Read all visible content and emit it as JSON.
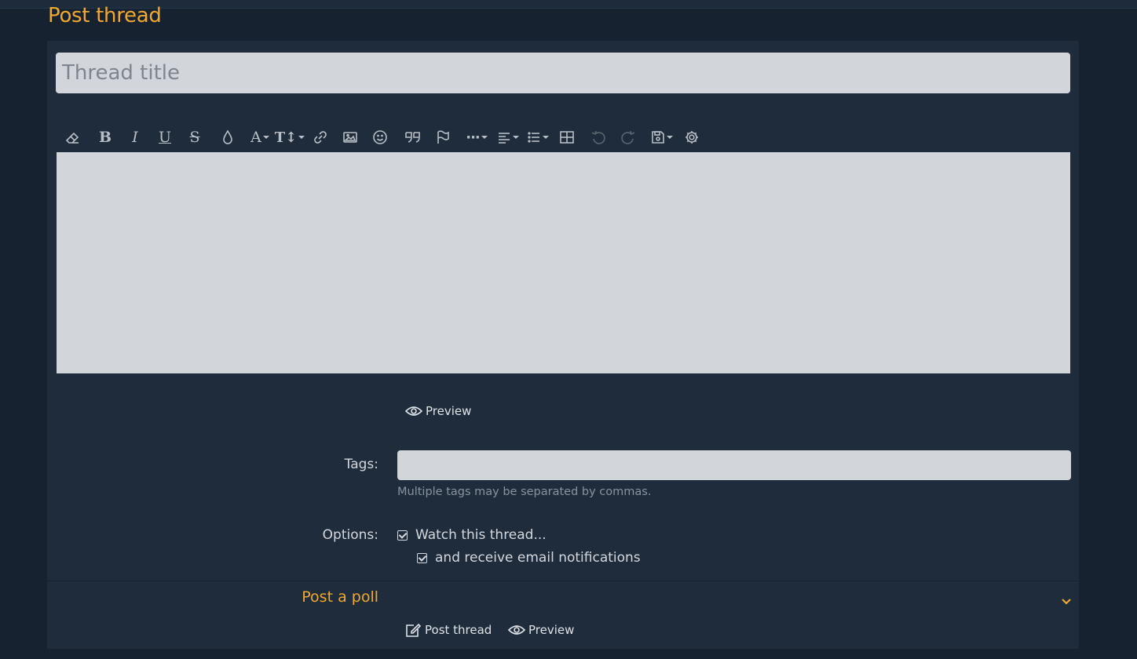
{
  "page": {
    "title": "Post thread"
  },
  "form": {
    "title_placeholder": "Thread title",
    "preview_label": "Preview",
    "tags_label": "Tags:",
    "tags_hint": "Multiple tags may be separated by commas.",
    "options_label": "Options:",
    "watch_label": "Watch this thread...",
    "email_label": "and receive email notifications",
    "poll_label": "Post a poll",
    "post_button": "Post thread",
    "preview_button": "Preview"
  },
  "toolbar": {
    "buttons": [
      "remove-formatting",
      "bold",
      "italic",
      "underline",
      "strikethrough",
      "text-color",
      "font-family",
      "font-size",
      "insert-link",
      "insert-image",
      "insert-smilie",
      "quote",
      "spoiler",
      "more-options",
      "alignment",
      "lists",
      "insert-table",
      "undo",
      "redo",
      "drafts",
      "toggle-bbcode"
    ]
  },
  "colors": {
    "accent": "#f0a92e",
    "background": "#172230",
    "panel": "#1e2c3c",
    "input": "#d2d5da"
  }
}
